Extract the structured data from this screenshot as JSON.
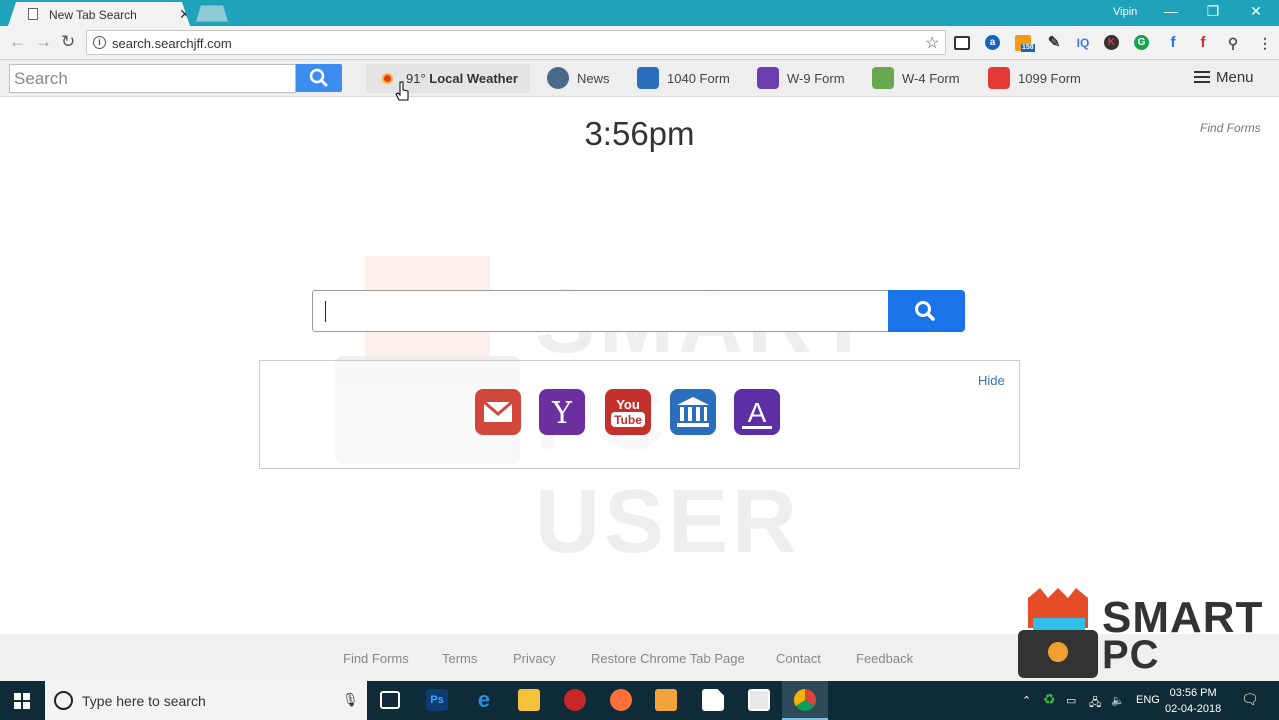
{
  "browser": {
    "tab_title": "New Tab Search",
    "tab_close": "✕",
    "profile_name": "Vipin",
    "window_controls": [
      "—",
      "❐",
      "✕"
    ],
    "url": "search.searchjff.com",
    "extension_badge": "158"
  },
  "toolbar": {
    "search_placeholder": "Search",
    "weather": {
      "temp": "91°",
      "label": "Local Weather"
    },
    "links": [
      "News",
      "1040 Form",
      "W-9 Form",
      "W-4 Form",
      "1099 Form"
    ],
    "menu_label": "Menu"
  },
  "main": {
    "time": "3:56pm",
    "find_forms": "Find Forms",
    "hide_label": "Hide",
    "apps": [
      "mail-icon",
      "yahoo-icon",
      "youtube-icon",
      "bank-icon",
      "form-icon"
    ]
  },
  "footer": {
    "links": [
      "Find Forms",
      "Terms",
      "Privacy",
      "Restore Chrome Tab Page",
      "Contact",
      "Feedback"
    ]
  },
  "watermark": {
    "line1": "SMART",
    "line2": "PC USER"
  },
  "taskbar": {
    "search_text": "Type here to search",
    "language": "ENG",
    "time": "03:56 PM",
    "date": "02-04-2018"
  },
  "colors": {
    "tab_bar": "#1fa3bb",
    "search_button": "#1a73e8",
    "taskbar": "#0f2b38"
  }
}
